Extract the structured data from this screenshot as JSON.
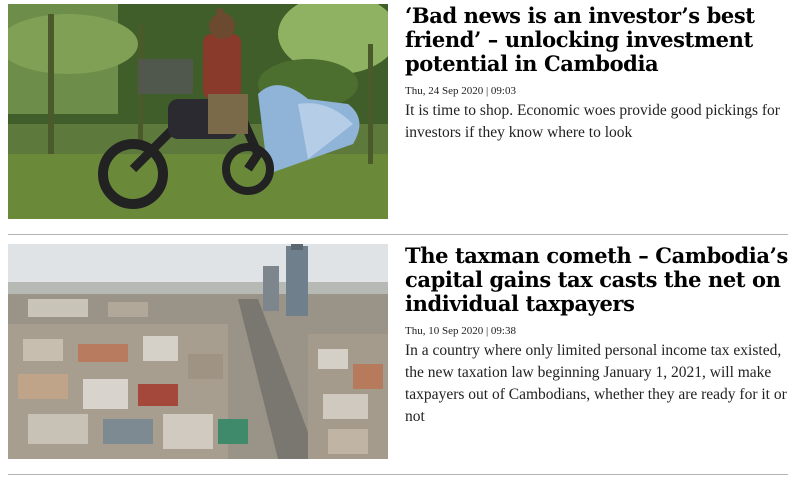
{
  "articles": [
    {
      "headline": "‘Bad news is an investor’s best friend’ – unlocking investment potential in Cambodia",
      "date": "Thu, 24 Sep 2020 | 09:03",
      "summary": "It is time to shop. Economic woes provide good pickings for investors if they know where to look",
      "image_icon": "motorbike-banana-plantation-photo"
    },
    {
      "headline": "The taxman cometh – Cambodia’s capital gains tax casts the net on individual taxpayers",
      "date": "Thu, 10 Sep 2020 | 09:38",
      "summary": "In a country where only limited personal income tax existed, the new taxation law beginning January 1, 2021, will make taxpayers out of Cambodians, whether they are ready for it or not",
      "image_icon": "phnom-penh-skyline-photo"
    }
  ],
  "colors": {
    "headline": "#000000",
    "divider": "#b5b5b5",
    "text": "#222222"
  }
}
